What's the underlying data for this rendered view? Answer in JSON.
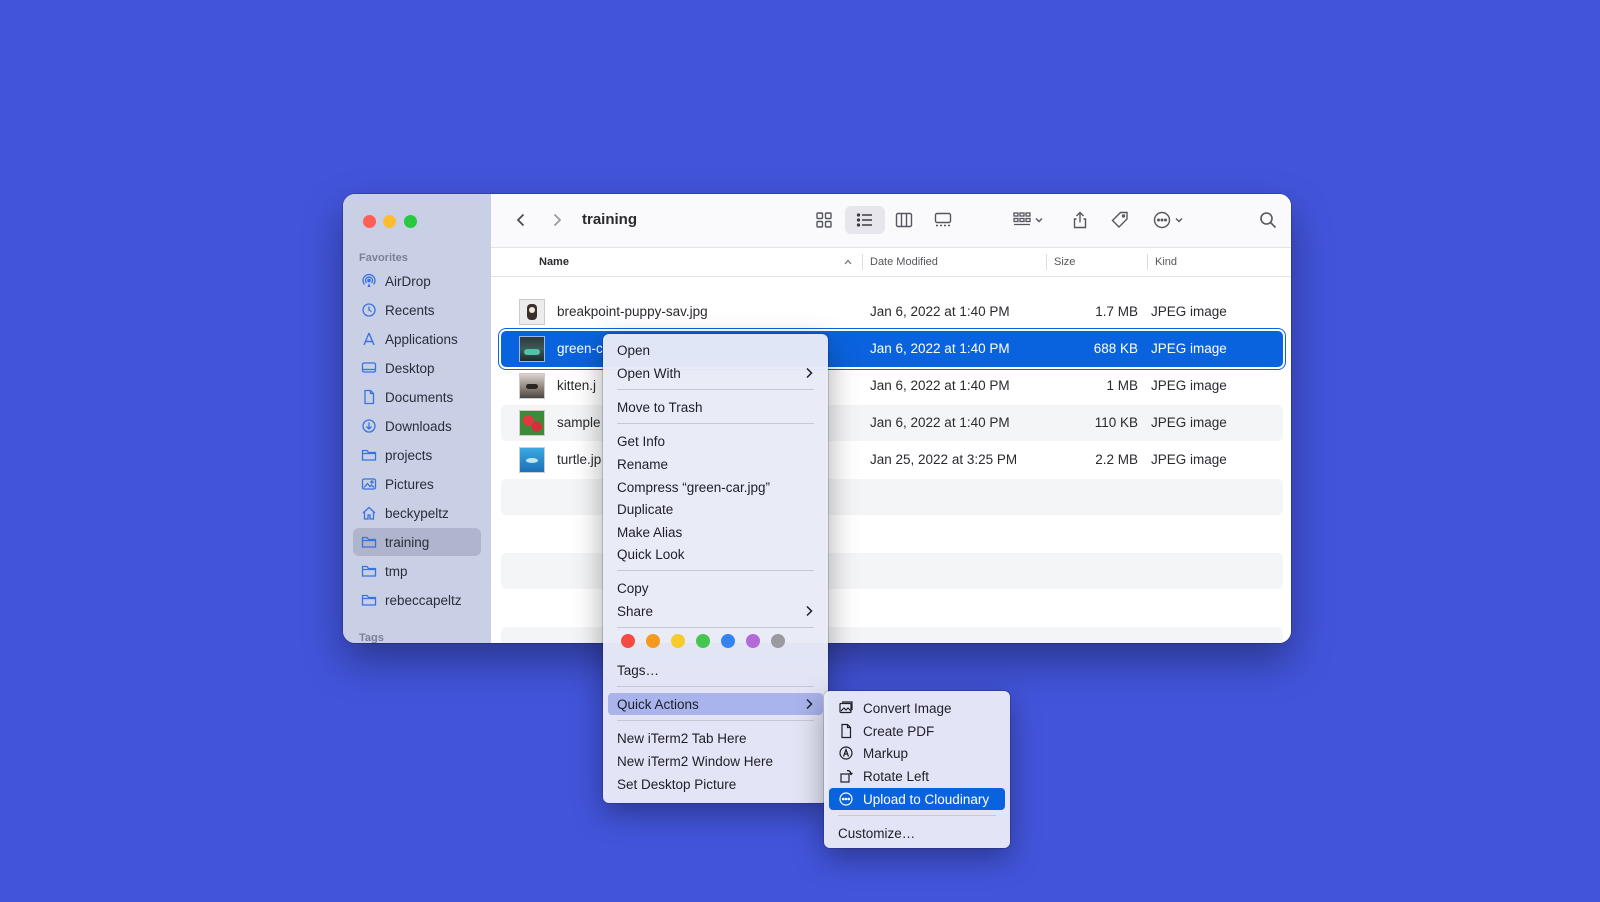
{
  "window": {
    "title": "training"
  },
  "sidebar": {
    "favorites_heading": "Favorites",
    "tags_heading": "Tags",
    "items": [
      {
        "label": "AirDrop",
        "icon": "airdrop-icon"
      },
      {
        "label": "Recents",
        "icon": "clock-icon"
      },
      {
        "label": "Applications",
        "icon": "applications-icon"
      },
      {
        "label": "Desktop",
        "icon": "desktop-icon"
      },
      {
        "label": "Documents",
        "icon": "document-icon"
      },
      {
        "label": "Downloads",
        "icon": "download-icon"
      },
      {
        "label": "projects",
        "icon": "folder-icon"
      },
      {
        "label": "Pictures",
        "icon": "photo-icon"
      },
      {
        "label": "beckypeltz",
        "icon": "home-icon"
      },
      {
        "label": "training",
        "icon": "folder-icon",
        "active": true
      },
      {
        "label": "tmp",
        "icon": "folder-icon"
      },
      {
        "label": "rebeccapeltz",
        "icon": "folder-icon"
      }
    ]
  },
  "columns": {
    "name": "Name",
    "date": "Date Modified",
    "size": "Size",
    "kind": "Kind"
  },
  "files": [
    {
      "name": "breakpoint-puppy-sav.jpg",
      "date": "Jan 6, 2022 at 1:40 PM",
      "size": "1.7 MB",
      "kind": "JPEG image"
    },
    {
      "name": "green-c",
      "date": "Jan 6, 2022 at 1:40 PM",
      "size": "688 KB",
      "kind": "JPEG image",
      "selected": true
    },
    {
      "name": "kitten.j",
      "date": "Jan 6, 2022 at 1:40 PM",
      "size": "1 MB",
      "kind": "JPEG image"
    },
    {
      "name": "sample",
      "date": "Jan 6, 2022 at 1:40 PM",
      "size": "110 KB",
      "kind": "JPEG image"
    },
    {
      "name": "turtle.jp",
      "date": "Jan 25, 2022 at 3:25 PM",
      "size": "2.2 MB",
      "kind": "JPEG image"
    }
  ],
  "context_menu": {
    "open": "Open",
    "open_with": "Open With",
    "move_to_trash": "Move to Trash",
    "get_info": "Get Info",
    "rename": "Rename",
    "compress": "Compress “green-car.jpg”",
    "duplicate": "Duplicate",
    "make_alias": "Make Alias",
    "quick_look": "Quick Look",
    "copy": "Copy",
    "share": "Share",
    "tag_colors": [
      "#f44b42",
      "#f59a1f",
      "#f5cc2c",
      "#46c550",
      "#3583f0",
      "#b16ad6",
      "#9a9aa0"
    ],
    "tags": "Tags…",
    "quick_actions": "Quick Actions",
    "new_iterm_tab": "New iTerm2 Tab Here",
    "new_iterm_window": "New iTerm2 Window Here",
    "set_desktop_picture": "Set Desktop Picture"
  },
  "quick_actions_menu": {
    "convert_image": "Convert Image",
    "create_pdf": "Create PDF",
    "markup": "Markup",
    "rotate_left": "Rotate Left",
    "upload_cloudinary": "Upload to Cloudinary",
    "customize": "Customize…"
  },
  "colors": {
    "background": "#4254da",
    "selection": "#0a63de",
    "menu_highlight": "#a9b3ec"
  }
}
